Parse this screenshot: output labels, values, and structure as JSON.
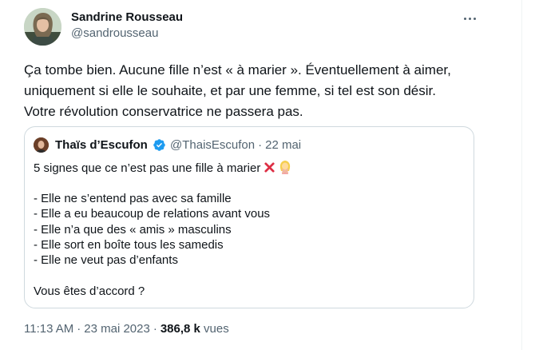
{
  "tweet": {
    "author": {
      "name": "Sandrine Rousseau",
      "handle": "@sandrousseau"
    },
    "text_lines": [
      "Ça tombe bien. Aucune fille n’est « à marier ». Éventuellement à aimer,",
      "uniquement si elle le souhaite, et par une femme, si tel est son désir.",
      "Votre révolution conservatrice ne passera pas."
    ],
    "quoted": {
      "author_name": "Thaïs d’Escufon",
      "handle": "@ThaisEscufon",
      "separator": "·",
      "date": "22 mai",
      "first_line": "5 signes que ce n’est pas une fille à marier",
      "list": [
        "- Elle ne s’entend pas avec sa famille",
        "- Elle a eu beaucoup de relations avant vous",
        "- Elle n’a que des « amis » masculins",
        "- Elle sort en boîte tous les samedis",
        "- Elle ne veut pas d’enfants"
      ],
      "closing": "Vous êtes d’accord ?"
    },
    "time": "11:13 AM",
    "separator": "·",
    "date": "23 mai 2023",
    "views_count": "386,8 k",
    "views_label": "vues"
  },
  "icons": {
    "more": "more-dots-icon",
    "verified": "verified-badge-icon",
    "emoji_1": "cross-mark-emoji",
    "emoji_2": "no-gesture-woman-emoji"
  },
  "colors": {
    "text_primary": "#0f1419",
    "text_secondary": "#536471",
    "verified_blue": "#1d9bf0",
    "cross_red": "#dd2e44",
    "border": "#cfd9de"
  }
}
